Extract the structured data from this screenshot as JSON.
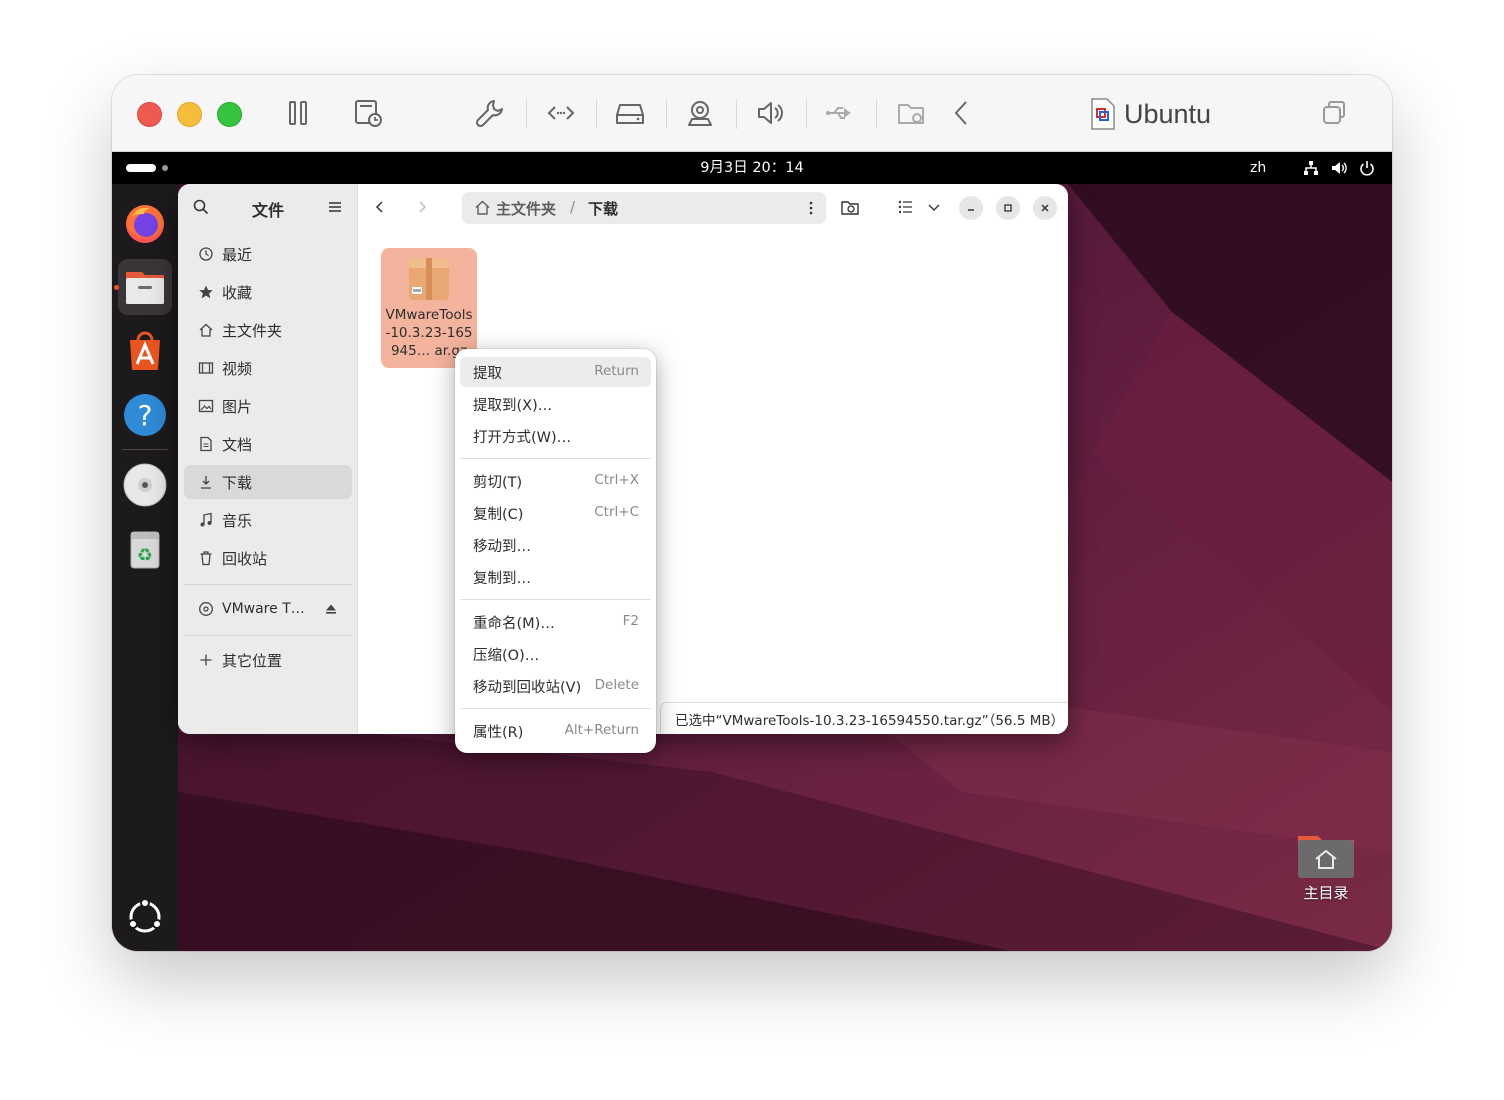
{
  "vm": {
    "name": "Ubuntu",
    "toolbar_icons": [
      "pause-icon",
      "snapshot-icon",
      "settings-wrench-icon",
      "code-icon",
      "disk-icon",
      "camera-icon",
      "sound-icon",
      "usb-icon",
      "shared-folder-icon",
      "back-chevron-icon",
      "window-copy-icon"
    ]
  },
  "topbar": {
    "clock": "9月3日  20：14",
    "lang": "zh"
  },
  "dock": {
    "items": [
      "Firefox",
      "文件",
      "应用中心",
      "帮助",
      "VMware Tools",
      "回收站",
      "显示应用"
    ]
  },
  "files": {
    "sidebar": {
      "title": "文件",
      "items": [
        {
          "label": "最近",
          "icon": "clock-icon"
        },
        {
          "label": "收藏",
          "icon": "star-icon"
        },
        {
          "label": "主文件夹",
          "icon": "home-icon"
        },
        {
          "label": "视频",
          "icon": "film-icon"
        },
        {
          "label": "图片",
          "icon": "image-icon"
        },
        {
          "label": "文档",
          "icon": "document-icon"
        },
        {
          "label": "下载",
          "icon": "download-icon"
        },
        {
          "label": "音乐",
          "icon": "music-icon"
        },
        {
          "label": "回收站",
          "icon": "trash-icon"
        }
      ],
      "device": "VMware T…",
      "other": "其它位置"
    },
    "path": {
      "home": "主文件夹",
      "separator": "/",
      "current": "下载"
    },
    "file": {
      "name": "VMwareTools-10.3.23-165945… ar.gz"
    },
    "status": "已选中“VMwareTools-10.3.23-16594550.tar.gz”（56.5 MB）"
  },
  "context_menu": {
    "groups": [
      [
        {
          "label": "提取",
          "accel": "Return"
        },
        {
          "label": "提取到(X)…",
          "accel": ""
        },
        {
          "label": "打开方式(W)…",
          "accel": ""
        }
      ],
      [
        {
          "label": "剪切(T)",
          "accel": "Ctrl+X"
        },
        {
          "label": "复制(C)",
          "accel": "Ctrl+C"
        },
        {
          "label": "移动到…",
          "accel": ""
        },
        {
          "label": "复制到…",
          "accel": ""
        }
      ],
      [
        {
          "label": "重命名(M)…",
          "accel": "F2"
        },
        {
          "label": "压缩(O)…",
          "accel": ""
        },
        {
          "label": "移动到回收站(V)",
          "accel": "Delete"
        }
      ],
      [
        {
          "label": "属性(R)",
          "accel": "Alt+Return"
        }
      ]
    ]
  },
  "desktop": {
    "home_label": "主目录"
  }
}
